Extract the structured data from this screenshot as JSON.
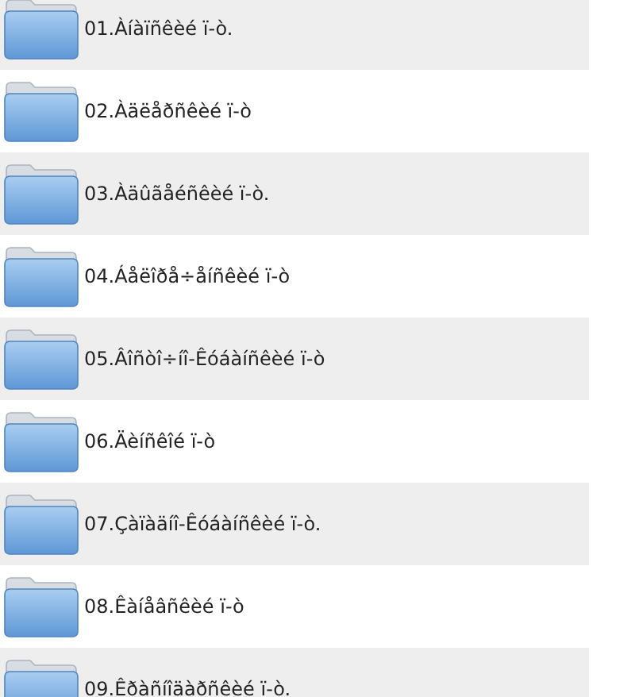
{
  "folders": [
    {
      "name": "01.Àíàïñêèé ï-ò."
    },
    {
      "name": "02.Àäëåðñêèé ï-ò"
    },
    {
      "name": "03.Àäûãåéñêèé ï-ò."
    },
    {
      "name": "04.Áåëîðå÷åíñêèé ï-ò"
    },
    {
      "name": "05.Âîñòî÷íî-Êóáàíñêèé ï-ò"
    },
    {
      "name": "06.Äèíñêîé ï-ò"
    },
    {
      "name": "07.Çàïàäíî-Êóáàíñêèé ï-ò."
    },
    {
      "name": "08.Êàíåâñêèé ï-ò"
    },
    {
      "name": "09.Êðàñíîäàðñêèé ï-ò."
    }
  ]
}
